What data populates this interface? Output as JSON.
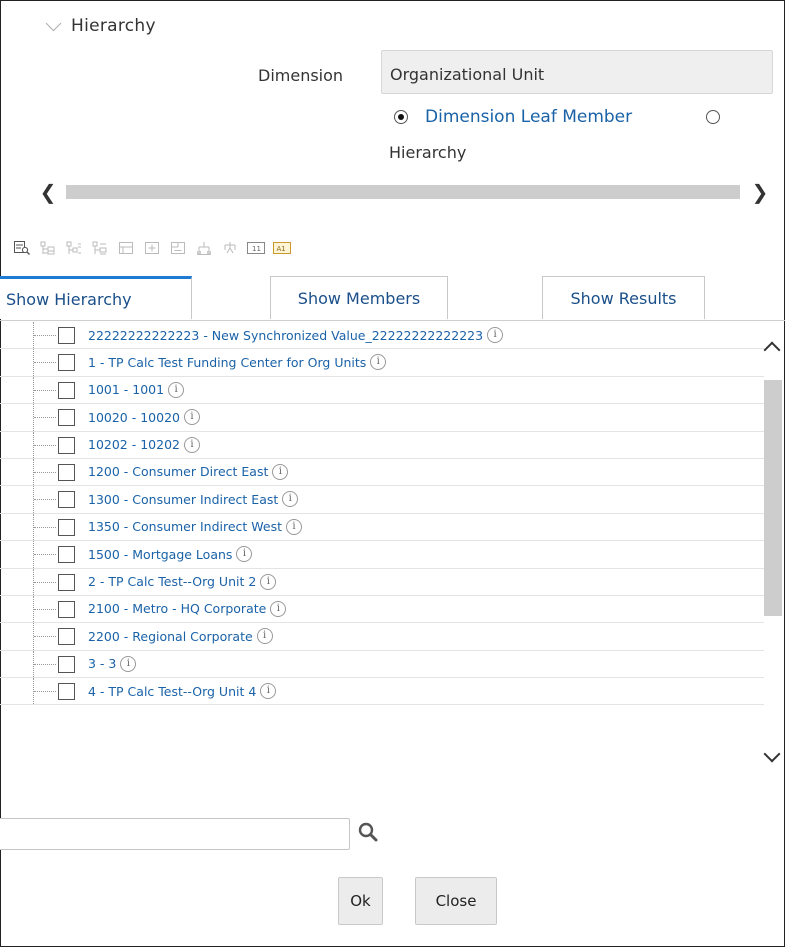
{
  "section": {
    "title": "Hierarchy"
  },
  "dimension": {
    "label": "Dimension",
    "value": "Organizational Unit"
  },
  "radio": {
    "option1": "Dimension Leaf Member",
    "option1_selected": true,
    "option2": "Hierarchy",
    "option2_selected": false
  },
  "toolbar": {
    "icons": [
      "find-icon",
      "expand-icon",
      "collapse-icon",
      "expand-branch-icon",
      "outline-icon",
      "plus-box-icon",
      "minus-box-icon",
      "hierarchy-icon",
      "tree-icon",
      "show-code-icon",
      "show-name-icon"
    ]
  },
  "tabs": {
    "hierarchy": "Show Hierarchy",
    "members": "Show Members",
    "results": "Show Results"
  },
  "tree": {
    "info_glyph": "i",
    "items": [
      {
        "label": "22222222222223 - New Synchronized Value_22222222222223"
      },
      {
        "label": "1 - TP Calc Test Funding Center for Org Units"
      },
      {
        "label": "1001 - 1001"
      },
      {
        "label": "10020 - 10020"
      },
      {
        "label": "10202 - 10202"
      },
      {
        "label": "1200 - Consumer Direct East"
      },
      {
        "label": "1300 - Consumer Indirect East"
      },
      {
        "label": "1350 - Consumer Indirect  West"
      },
      {
        "label": "1500 - Mortgage Loans"
      },
      {
        "label": "2 - TP Calc Test--Org Unit 2"
      },
      {
        "label": "2100 - Metro - HQ Corporate"
      },
      {
        "label": "2200 - Regional Corporate"
      },
      {
        "label": "3 - 3"
      },
      {
        "label": "4 - TP Calc Test--Org Unit 4"
      }
    ]
  },
  "search": {
    "value": "",
    "placeholder": ""
  },
  "buttons": {
    "ok": "Ok",
    "close": "Close"
  },
  "colors": {
    "link": "#1a62a8",
    "tab_active": "#1f7ad1",
    "scroll": "#cdcdcd"
  }
}
